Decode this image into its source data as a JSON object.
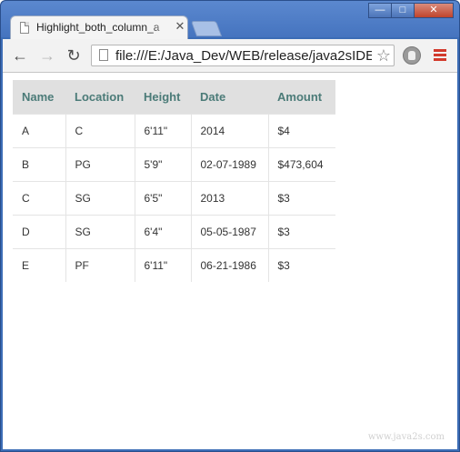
{
  "browser": {
    "tab_title": "Highlight_both_column_a",
    "tab_close": "✕",
    "url": "file:///E:/Java_Dev/WEB/release/java2sIDE",
    "back_icon": "arrow-left",
    "forward_icon": "arrow-right",
    "reload_icon": "reload",
    "star_icon": "star",
    "menu_icon": "hamburger",
    "win_minimize": "—",
    "win_maximize": "□",
    "win_close": "✕"
  },
  "table": {
    "headers": [
      "Name",
      "Location",
      "Height",
      "Date",
      "Amount"
    ],
    "rows": [
      [
        "A",
        "C",
        "6'11\"",
        "2014",
        "$4"
      ],
      [
        "B",
        "PG",
        "5'9\"",
        "02-07-1989",
        "$473,604"
      ],
      [
        "C",
        "SG",
        "6'5\"",
        "2013",
        "$3"
      ],
      [
        "D",
        "SG",
        "6'4\"",
        "05-05-1987",
        "$3"
      ],
      [
        "E",
        "PF",
        "6'11\"",
        "06-21-1986",
        "$3"
      ]
    ]
  },
  "watermark": "www.java2s.com",
  "colors": {
    "header_bg": "#e0e0e0",
    "header_text": "#4b7b78",
    "window_frame": "#3c6db6",
    "menu_accent": "#d23a2c"
  }
}
